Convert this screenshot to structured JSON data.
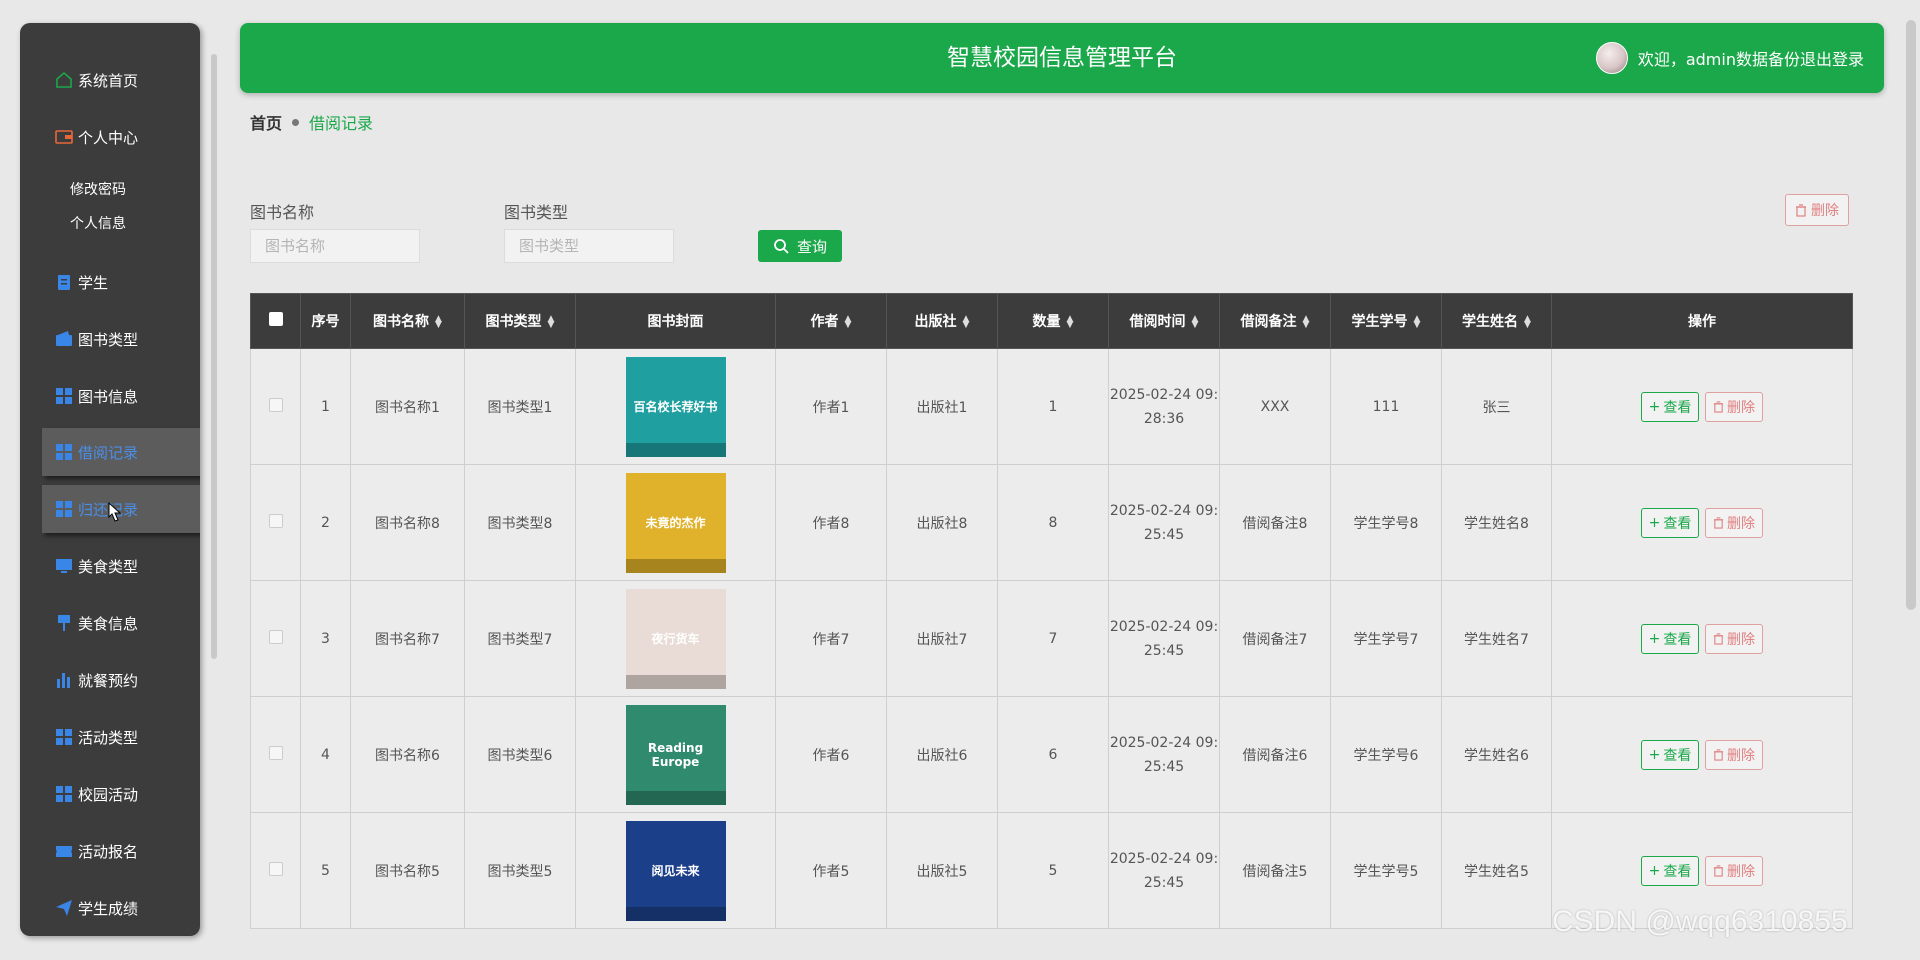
{
  "sidebar": {
    "items": [
      {
        "label": "系统首页",
        "icon": "home-icon"
      },
      {
        "label": "个人中心",
        "icon": "wallet-icon"
      },
      {
        "label": "学生",
        "icon": "clipboard-icon"
      },
      {
        "label": "图书类型",
        "icon": "wallet-icon"
      },
      {
        "label": "图书信息",
        "icon": "grid-icon"
      },
      {
        "label": "借阅记录",
        "icon": "grid-icon"
      },
      {
        "label": "归还记录",
        "icon": "grid-icon"
      },
      {
        "label": "美食类型",
        "icon": "monitor-icon"
      },
      {
        "label": "美食信息",
        "icon": "pin-icon"
      },
      {
        "label": "就餐预约",
        "icon": "bar-chart-icon"
      },
      {
        "label": "活动类型",
        "icon": "grid-icon"
      },
      {
        "label": "校园活动",
        "icon": "grid-icon"
      },
      {
        "label": "活动报名",
        "icon": "ticket-icon"
      },
      {
        "label": "学生成绩",
        "icon": "send-icon"
      }
    ],
    "subitems": [
      "修改密码",
      "个人信息"
    ]
  },
  "header": {
    "title": "智慧校园信息管理平台",
    "welcome": "欢迎，admin",
    "backup": "数据备份",
    "logout": "退出登录"
  },
  "breadcrumb": {
    "home": "首页",
    "current": "借阅记录"
  },
  "search": {
    "name_label": "图书名称",
    "name_placeholder": "图书名称",
    "type_label": "图书类型",
    "type_placeholder": "图书类型",
    "query_label": "查询",
    "delete_label": "删除"
  },
  "table": {
    "headers": [
      "序号",
      "图书名称",
      "图书类型",
      "图书封面",
      "作者",
      "出版社",
      "数量",
      "借阅时间",
      "借阅备注",
      "学生学号",
      "学生姓名",
      "操作"
    ],
    "view_label": "查看",
    "delete_label": "删除",
    "rows": [
      {
        "no": "1",
        "name": "图书名称1",
        "type": "图书类型1",
        "author": "作者1",
        "publisher": "出版社1",
        "qty": "1",
        "time1": "2025-02-24 09:",
        "time2": "28:36",
        "note": "XXX",
        "sid": "111",
        "sname": "张三",
        "cover_color": "#1f9fa0",
        "cover_text": "百名校长荐好书"
      },
      {
        "no": "2",
        "name": "图书名称8",
        "type": "图书类型8",
        "author": "作者8",
        "publisher": "出版社8",
        "qty": "8",
        "time1": "2025-02-24 09:",
        "time2": "25:45",
        "note": "借阅备注8",
        "sid": "学生学号8",
        "sname": "学生姓名8",
        "cover_color": "#e0b12a",
        "cover_text": "未竟的杰作"
      },
      {
        "no": "3",
        "name": "图书名称7",
        "type": "图书类型7",
        "author": "作者7",
        "publisher": "出版社7",
        "qty": "7",
        "time1": "2025-02-24 09:",
        "time2": "25:45",
        "note": "借阅备注7",
        "sid": "学生学号7",
        "sname": "学生姓名7",
        "cover_color": "#e9dcd6",
        "cover_text": "夜行货车"
      },
      {
        "no": "4",
        "name": "图书名称6",
        "type": "图书类型6",
        "author": "作者6",
        "publisher": "出版社6",
        "qty": "6",
        "time1": "2025-02-24 09:",
        "time2": "25:45",
        "note": "借阅备注6",
        "sid": "学生学号6",
        "sname": "学生姓名6",
        "cover_color": "#2f8a6e",
        "cover_text": "Reading Europe"
      },
      {
        "no": "5",
        "name": "图书名称5",
        "type": "图书类型5",
        "author": "作者5",
        "publisher": "出版社5",
        "qty": "5",
        "time1": "2025-02-24 09:",
        "time2": "25:45",
        "note": "借阅备注5",
        "sid": "学生学号5",
        "sname": "学生姓名5",
        "cover_color": "#1c3f8a",
        "cover_text": "阅见未来"
      }
    ]
  },
  "watermark": "CSDN @wqq6310855",
  "colors": {
    "accent": "#1ba84a",
    "sidebar": "#3c3c3c",
    "danger": "#e08080"
  }
}
